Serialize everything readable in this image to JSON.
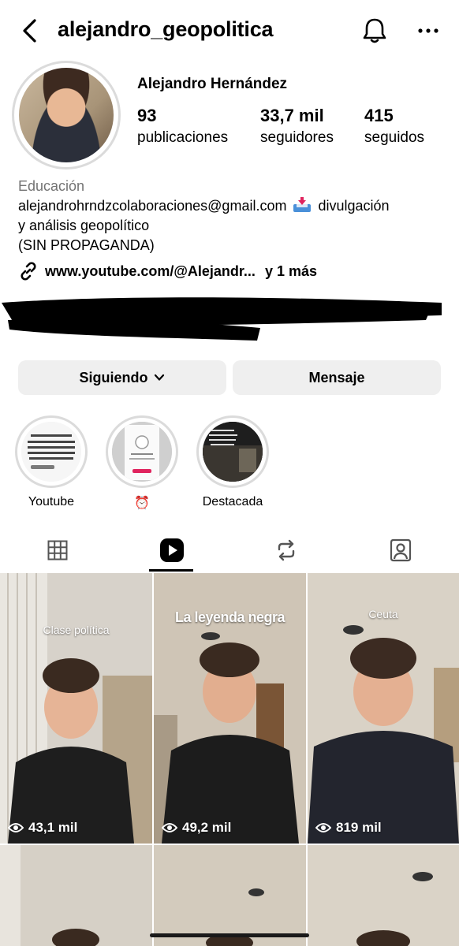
{
  "header": {
    "username": "alejandro_geopolitica"
  },
  "profile": {
    "full_name": "Alejandro Hernández",
    "stats": [
      {
        "value": "93",
        "label": "publicaciones"
      },
      {
        "value": "33,7 mil",
        "label": "seguidores"
      },
      {
        "value": "415",
        "label": "seguidos"
      }
    ],
    "category": "Educación",
    "bio_email": "alejandrohrndzcolaboraciones@gmail.com",
    "bio_line1_tail": "divulgación",
    "bio_line2": "y análisis geopolítico",
    "bio_line3": "(SIN PROPAGANDA)",
    "link_text": "www.youtube.com/@Alejandr...",
    "link_more": "y 1 más"
  },
  "buttons": {
    "following": "Siguiendo",
    "message": "Mensaje"
  },
  "highlights": [
    {
      "label": "Youtube"
    },
    {
      "label": "⏰"
    },
    {
      "label": "Destacada"
    }
  ],
  "tabs": [
    {
      "icon": "grid-icon"
    },
    {
      "icon": "reels-icon",
      "active": true
    },
    {
      "icon": "reposts-icon"
    },
    {
      "icon": "tagged-icon"
    }
  ],
  "posts": [
    {
      "caption": "Clase política",
      "views": "43,1 mil"
    },
    {
      "caption": "La leyenda negra",
      "views": "49,2 mil"
    },
    {
      "caption": "Ceuta",
      "views": "819 mil"
    },
    {
      "caption": "",
      "views": ""
    },
    {
      "caption": "",
      "views": ""
    },
    {
      "caption": "",
      "views": ""
    }
  ],
  "colors": {
    "button_bg": "#efefef",
    "secondary_text": "#737373",
    "ring": "#dbdbdb"
  }
}
